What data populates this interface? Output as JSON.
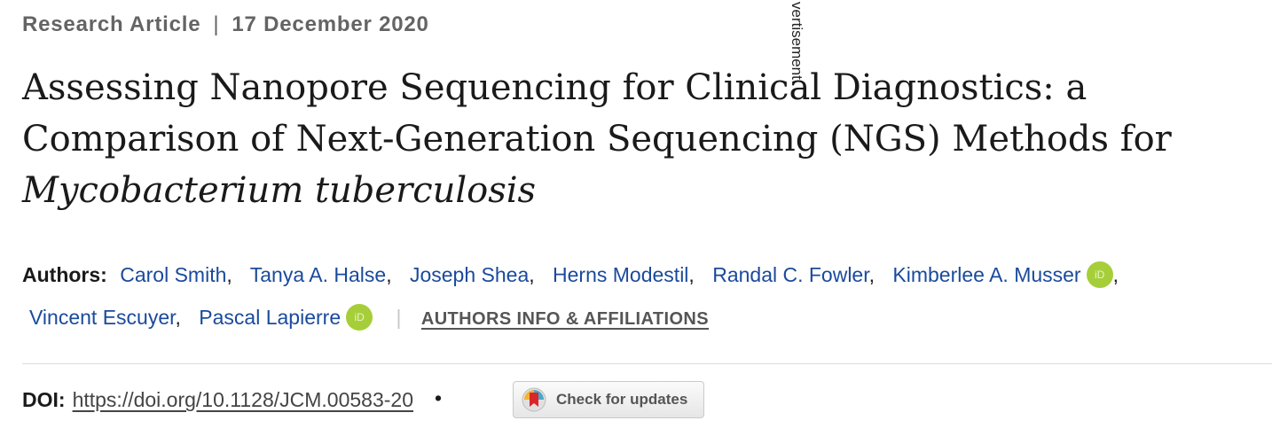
{
  "meta": {
    "type": "Research Article",
    "separator": "|",
    "date": "17 December 2020"
  },
  "ad_label": "vertisement",
  "title": {
    "line1": "Assessing Nanopore Sequencing for Clinical Diagnostics: a",
    "line2": "Comparison of Next-Generation Sequencing (NGS) Methods for",
    "line3_italic": "Mycobacterium tuberculosis"
  },
  "authors": {
    "label": "Authors",
    "list": [
      "Carol Smith",
      "Tanya A. Halse",
      "Joseph Shea",
      "Herns Modestil",
      "Randal C. Fowler",
      "Kimberlee A. Musser",
      "Vincent Escuyer",
      "Pascal Lapierre"
    ],
    "orcid_badge": "iD",
    "affiliations_link": "AUTHORS INFO & AFFILIATIONS"
  },
  "doi": {
    "label": "DOI:",
    "link": "https://doi.org/10.1128/JCM.00583-20",
    "bullet": "•"
  },
  "check_updates": {
    "label": "Check for updates"
  },
  "colors": {
    "author_link": "#1a4a9c",
    "orcid": "#a6ce39",
    "meta_text": "#646464"
  }
}
